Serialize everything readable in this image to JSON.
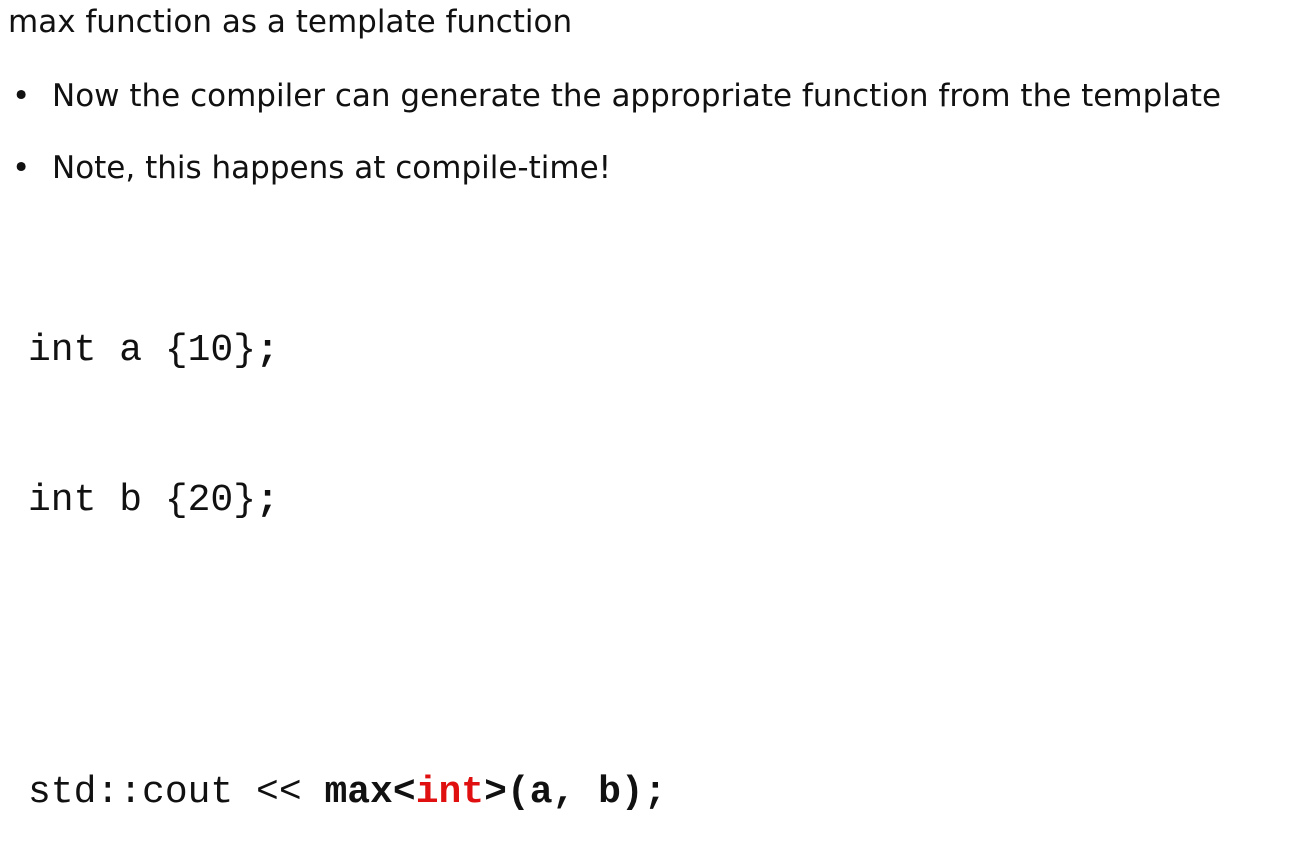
{
  "title": "max function as a template function",
  "bullets": [
    {
      "marker": "•",
      "text": "Now the compiler can generate the appropriate function from the template"
    },
    {
      "marker": "•",
      "text": "Note, this happens at compile-time!"
    }
  ],
  "code": {
    "line1": {
      "text": "int a {10}",
      "semi": ";"
    },
    "line2": {
      "text": "int b {20}",
      "semi": ";"
    },
    "line3": {
      "prefix": "std::cout << ",
      "call_name": "max",
      "lt": "<",
      "type_arg": "int",
      "args": ">(a, b)",
      "semi": ";"
    }
  },
  "colors": {
    "text": "#111111",
    "highlight": "#e01010",
    "background": "#ffffff"
  }
}
